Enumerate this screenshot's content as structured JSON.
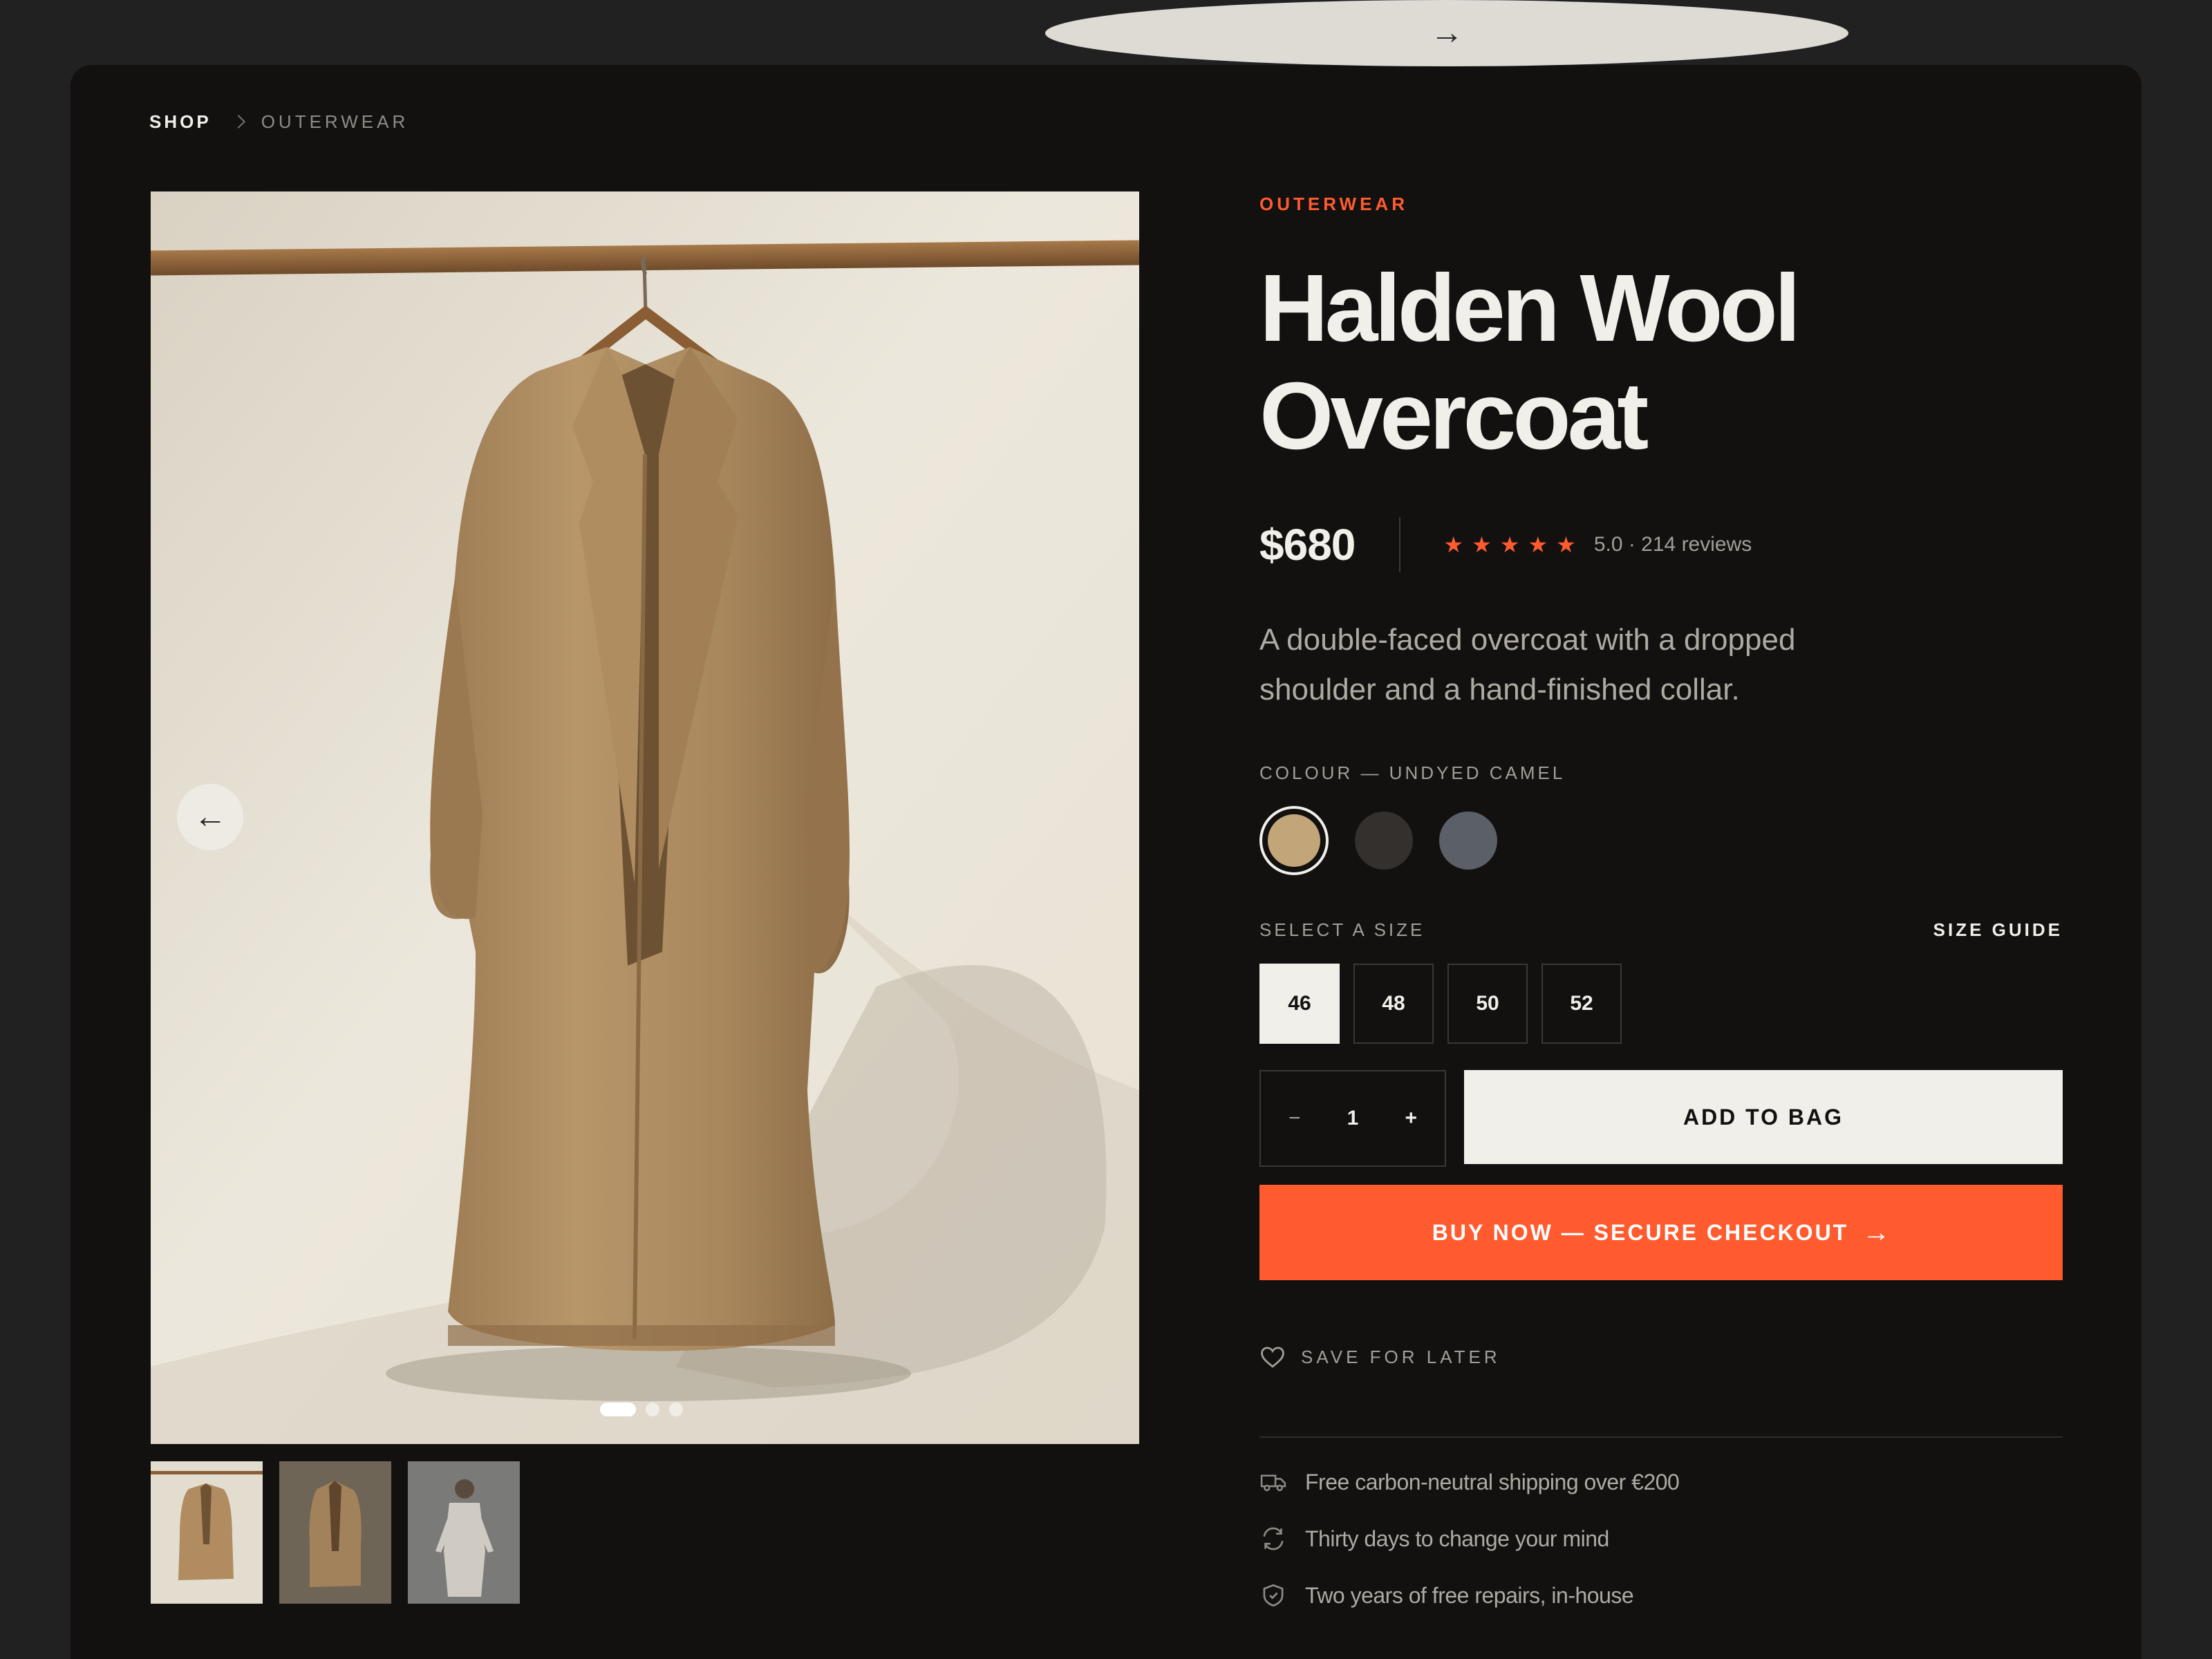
{
  "breadcrumb": {
    "items": [
      "SHOP",
      "OUTERWEAR"
    ]
  },
  "gallery": {
    "prev_icon": "arrow-left-icon",
    "next_icon": "arrow-right-icon",
    "prev_glyph": "←",
    "next_glyph": "→",
    "slide_count": 3,
    "active_slide": 1,
    "thumbnails": 3
  },
  "product": {
    "category": "OUTERWEAR",
    "title_line1": "Halden Wool",
    "title_line2": "Overcoat",
    "price": "$680",
    "rating_stars": 5,
    "rating_text": "5.0 · 214 reviews",
    "description": "A double-faced overcoat with a dropped shoulder and a hand-finished collar."
  },
  "colour": {
    "label": "COLOUR — UNDYED CAMEL",
    "swatches": [
      "#c3a57a",
      "#33302e",
      "#5a5f68"
    ],
    "selected_index": 0
  },
  "size": {
    "label": "SELECT A SIZE",
    "guide_label": "SIZE GUIDE",
    "options": [
      "46",
      "48",
      "50",
      "52"
    ],
    "selected": "46"
  },
  "quantity": {
    "minus": "−",
    "value": "1",
    "plus": "+"
  },
  "actions": {
    "add_to_bag": "ADD TO BAG",
    "buy_now": "BUY NOW — SECURE CHECKOUT",
    "buy_arrow": "→",
    "save_for_later": "SAVE FOR LATER"
  },
  "perks": [
    {
      "icon": "truck-icon",
      "text": "Free carbon-neutral shipping over €200"
    },
    {
      "icon": "refresh-icon",
      "text": "Thirty days to change your mind"
    },
    {
      "icon": "shield-icon",
      "text": "Two years of free repairs, in-house"
    }
  ],
  "colors": {
    "accent": "#ff5b2e",
    "background": "#121110",
    "page": "#222121",
    "text": "#f1efe9"
  }
}
